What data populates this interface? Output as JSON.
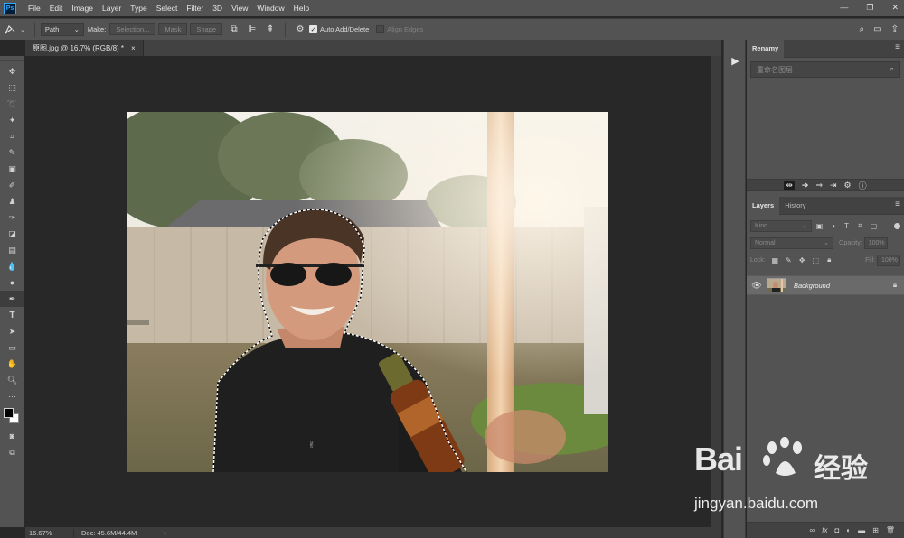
{
  "app": {
    "logo": "Ps",
    "menu": [
      "File",
      "Edit",
      "Image",
      "Layer",
      "Type",
      "Select",
      "Filter",
      "3D",
      "View",
      "Window",
      "Help"
    ],
    "window_controls": [
      "—",
      "❐",
      "✕"
    ]
  },
  "options": {
    "tool_icon": "pen-icon",
    "mode_value": "Path",
    "make_label": "Make:",
    "selection_label": "Selection...",
    "mask_label": "Mask",
    "shape_label": "Shape",
    "auto_add_delete_label": "Auto Add/Delete",
    "auto_add_delete_checked": true,
    "align_edges_label": "Align Edges",
    "align_edges_checked": false
  },
  "document": {
    "tab_title": "原图.jpg @ 16.7% (RGB/8) *",
    "close_glyph": "×"
  },
  "status": {
    "zoom": "16.67%",
    "doc_info": "Doc: 45.6M/44.4M",
    "arrow": "›"
  },
  "panels": {
    "renamy": {
      "tab": "Renamy",
      "search_placeholder": "重命名图层"
    },
    "layers": {
      "tabs": [
        "Layers",
        "History"
      ],
      "kind_label": "Kind",
      "blend_mode": "Normal",
      "opacity_label": "Opacity:",
      "opacity_value": "100%",
      "lock_label": "Lock:",
      "fill_label": "Fill:",
      "fill_value": "100%",
      "layer_name": "Background"
    }
  },
  "watermark": {
    "brand": "Bai",
    "brand_cn": "经验",
    "url": "jingyan.baidu.com"
  },
  "colors": {
    "foreground": "#000000",
    "background": "#ffffff",
    "ui_dark": "#535353",
    "canvas_bg": "#282828"
  }
}
